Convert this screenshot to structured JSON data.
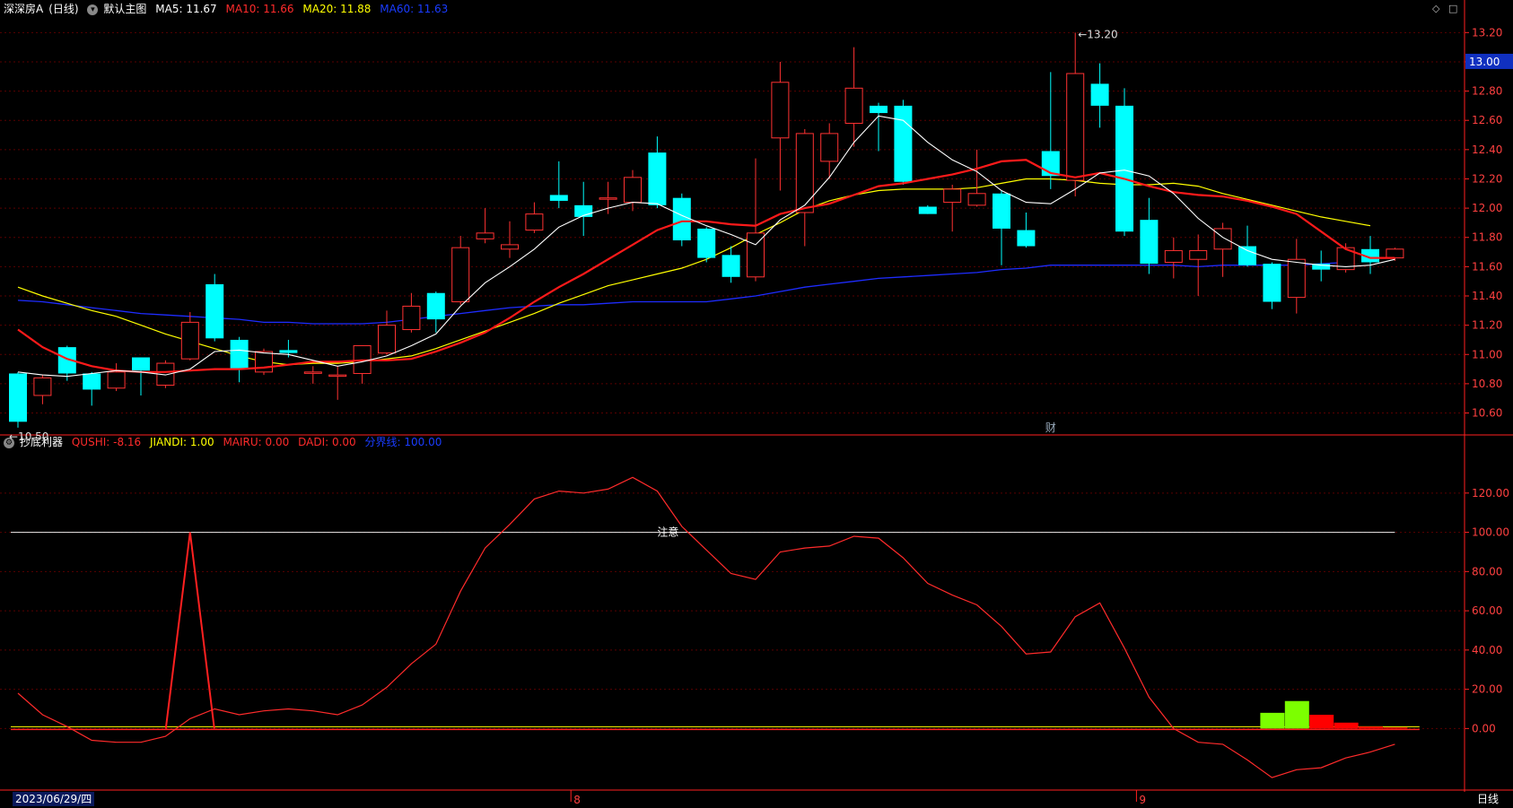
{
  "header": {
    "stock_name": "深深房A",
    "period": "(日线)",
    "template": "默认主图",
    "ma": [
      {
        "label": "MA5: 11.67",
        "color": "#ffffff"
      },
      {
        "label": "MA10: 11.66",
        "color": "#ff2b2b"
      },
      {
        "label": "MA20: 11.88",
        "color": "#ffff00"
      },
      {
        "label": "MA60: 11.63",
        "color": "#1a3cff"
      }
    ]
  },
  "indicator_header": {
    "name": "抄底利器",
    "values": [
      {
        "label": "QUSHI: -8.16",
        "color": "#ff2b2b"
      },
      {
        "label": "JIANDI: 1.00",
        "color": "#ffff00"
      },
      {
        "label": "MAIRU: 0.00",
        "color": "#ff2b2b"
      },
      {
        "label": "DADI: 0.00",
        "color": "#ff2b2b"
      },
      {
        "label": "分界线: 100.00",
        "color": "#1a3cff"
      }
    ]
  },
  "colors": {
    "up": "#ff3232",
    "down": "#00ffff",
    "ma5": "#ffffff",
    "ma10": "#ff1a1a",
    "ma20": "#ffff00",
    "ma60": "#1e2cff",
    "axis": "#ff2020",
    "grid": "#5a0000"
  },
  "chart_data": [
    {
      "type": "candlestick",
      "title": "深深房A (日线)",
      "ylim": [
        10.45,
        13.3
      ],
      "yticks": [
        "13.20",
        "13.00",
        "12.80",
        "12.60",
        "12.40",
        "12.20",
        "12.00",
        "11.80",
        "11.60",
        "11.40",
        "11.20",
        "11.00",
        "10.80",
        "10.60"
      ],
      "current_price": "13.00",
      "high_label": "13.20",
      "low_label": "10.50",
      "marker_label": "财",
      "candles": [
        {
          "o": 10.87,
          "c": 10.54,
          "h": 10.88,
          "l": 10.5
        },
        {
          "o": 10.72,
          "c": 10.84,
          "h": 10.86,
          "l": 10.66
        },
        {
          "o": 11.05,
          "c": 10.87,
          "h": 11.06,
          "l": 10.82
        },
        {
          "o": 10.87,
          "c": 10.76,
          "h": 10.88,
          "l": 10.65
        },
        {
          "o": 10.77,
          "c": 10.88,
          "h": 10.94,
          "l": 10.75
        },
        {
          "o": 10.98,
          "c": 10.89,
          "h": 10.98,
          "l": 10.72
        },
        {
          "o": 10.79,
          "c": 10.94,
          "h": 10.96,
          "l": 10.77
        },
        {
          "o": 10.97,
          "c": 11.22,
          "h": 11.29,
          "l": 10.96
        },
        {
          "o": 11.48,
          "c": 11.11,
          "h": 11.55,
          "l": 11.09
        },
        {
          "o": 11.1,
          "c": 10.9,
          "h": 11.12,
          "l": 10.81
        },
        {
          "o": 10.88,
          "c": 11.02,
          "h": 11.04,
          "l": 10.86
        },
        {
          "o": 11.03,
          "c": 11.01,
          "h": 11.1,
          "l": 10.98
        },
        {
          "o": 10.88,
          "c": 10.88,
          "h": 10.92,
          "l": 10.8
        },
        {
          "o": 10.86,
          "c": 10.86,
          "h": 10.92,
          "l": 10.69
        },
        {
          "o": 10.87,
          "c": 11.06,
          "h": 11.06,
          "l": 10.8
        },
        {
          "o": 11.01,
          "c": 11.2,
          "h": 11.3,
          "l": 11.0
        },
        {
          "o": 11.17,
          "c": 11.33,
          "h": 11.42,
          "l": 11.15
        },
        {
          "o": 11.42,
          "c": 11.24,
          "h": 11.43,
          "l": 11.15
        },
        {
          "o": 11.36,
          "c": 11.73,
          "h": 11.81,
          "l": 11.34
        },
        {
          "o": 11.79,
          "c": 11.83,
          "h": 12.0,
          "l": 11.76
        },
        {
          "o": 11.72,
          "c": 11.75,
          "h": 11.91,
          "l": 11.66
        },
        {
          "o": 11.85,
          "c": 11.96,
          "h": 12.04,
          "l": 11.83
        },
        {
          "o": 12.09,
          "c": 12.05,
          "h": 12.32,
          "l": 12.0
        },
        {
          "o": 12.02,
          "c": 11.94,
          "h": 12.18,
          "l": 11.81
        },
        {
          "o": 12.07,
          "c": 12.07,
          "h": 12.18,
          "l": 11.96
        },
        {
          "o": 12.04,
          "c": 12.21,
          "h": 12.26,
          "l": 11.98
        },
        {
          "o": 12.38,
          "c": 12.02,
          "h": 12.49,
          "l": 12.0
        },
        {
          "o": 12.07,
          "c": 11.78,
          "h": 12.1,
          "l": 11.74
        },
        {
          "o": 11.86,
          "c": 11.66,
          "h": 11.87,
          "l": 11.63
        },
        {
          "o": 11.68,
          "c": 11.53,
          "h": 11.74,
          "l": 11.49
        },
        {
          "o": 11.53,
          "c": 11.83,
          "h": 12.34,
          "l": 11.5
        },
        {
          "o": 12.48,
          "c": 12.86,
          "h": 13.0,
          "l": 12.12
        },
        {
          "o": 11.97,
          "c": 12.51,
          "h": 12.54,
          "l": 11.74
        },
        {
          "o": 12.32,
          "c": 12.51,
          "h": 12.58,
          "l": 12.2
        },
        {
          "o": 12.58,
          "c": 12.82,
          "h": 13.1,
          "l": 12.42
        },
        {
          "o": 12.7,
          "c": 12.65,
          "h": 12.72,
          "l": 12.39
        },
        {
          "o": 12.7,
          "c": 12.18,
          "h": 12.74,
          "l": 12.16
        },
        {
          "o": 12.01,
          "c": 11.96,
          "h": 12.02,
          "l": 11.96
        },
        {
          "o": 12.04,
          "c": 12.13,
          "h": 12.16,
          "l": 11.84
        },
        {
          "o": 12.02,
          "c": 12.1,
          "h": 12.4,
          "l": 12.01
        },
        {
          "o": 12.1,
          "c": 11.86,
          "h": 12.12,
          "l": 11.61
        },
        {
          "o": 11.85,
          "c": 11.74,
          "h": 11.97,
          "l": 11.73
        },
        {
          "o": 12.39,
          "c": 12.22,
          "h": 12.93,
          "l": 12.13
        },
        {
          "o": 12.19,
          "c": 12.92,
          "h": 13.2,
          "l": 12.08
        },
        {
          "o": 12.85,
          "c": 12.7,
          "h": 12.99,
          "l": 12.55
        },
        {
          "o": 12.7,
          "c": 11.84,
          "h": 12.82,
          "l": 11.81
        },
        {
          "o": 11.92,
          "c": 11.62,
          "h": 12.07,
          "l": 11.55
        },
        {
          "o": 11.63,
          "c": 11.71,
          "h": 11.8,
          "l": 11.52
        },
        {
          "o": 11.65,
          "c": 11.71,
          "h": 11.82,
          "l": 11.4
        },
        {
          "o": 11.72,
          "c": 11.86,
          "h": 11.9,
          "l": 11.53
        },
        {
          "o": 11.74,
          "c": 11.61,
          "h": 11.88,
          "l": 11.6
        },
        {
          "o": 11.62,
          "c": 11.36,
          "h": 11.63,
          "l": 11.31
        },
        {
          "o": 11.39,
          "c": 11.65,
          "h": 11.79,
          "l": 11.28
        },
        {
          "o": 11.62,
          "c": 11.58,
          "h": 11.71,
          "l": 11.5
        },
        {
          "o": 11.58,
          "c": 11.73,
          "h": 11.76,
          "l": 11.56
        },
        {
          "o": 11.72,
          "c": 11.63,
          "h": 11.81,
          "l": 11.55
        },
        {
          "o": 11.66,
          "c": 11.72,
          "h": 11.73,
          "l": 11.64
        }
      ],
      "ma5": [
        10.88,
        10.86,
        10.85,
        10.87,
        10.89,
        10.88,
        10.86,
        10.9,
        11.02,
        11.03,
        11.01,
        11.0,
        10.96,
        10.92,
        10.95,
        10.99,
        11.06,
        11.14,
        11.33,
        11.49,
        11.6,
        11.72,
        11.87,
        11.95,
        12.0,
        12.04,
        12.03,
        11.95,
        11.88,
        11.82,
        11.75,
        11.92,
        12.02,
        12.21,
        12.45,
        12.63,
        12.6,
        12.45,
        12.33,
        12.25,
        12.12,
        12.04,
        12.03,
        12.13,
        12.24,
        12.26,
        12.22,
        12.1,
        11.93,
        11.8,
        11.71,
        11.65,
        11.63,
        11.61,
        11.6,
        11.61,
        11.65
      ],
      "ma10": [
        11.17,
        11.05,
        10.97,
        10.92,
        10.89,
        10.88,
        10.88,
        10.89,
        10.9,
        10.9,
        10.91,
        10.93,
        10.95,
        10.95,
        10.96,
        10.96,
        10.97,
        11.02,
        11.08,
        11.15,
        11.25,
        11.36,
        11.46,
        11.55,
        11.65,
        11.75,
        11.85,
        11.91,
        11.91,
        11.89,
        11.88,
        11.96,
        12.0,
        12.03,
        12.09,
        12.15,
        12.17,
        12.2,
        12.23,
        12.27,
        12.32,
        12.33,
        12.24,
        12.21,
        12.24,
        12.2,
        12.15,
        12.11,
        12.09,
        12.08,
        12.05,
        12.01,
        11.96,
        11.84,
        11.72,
        11.66,
        11.66
      ],
      "ma20": [
        11.46,
        11.4,
        11.35,
        11.3,
        11.26,
        11.2,
        11.14,
        11.09,
        11.04,
        10.99,
        10.95,
        10.93,
        10.94,
        10.94,
        10.95,
        10.97,
        10.99,
        11.04,
        11.1,
        11.16,
        11.22,
        11.28,
        11.35,
        11.41,
        11.47,
        11.51,
        11.55,
        11.59,
        11.65,
        11.73,
        11.82,
        11.9,
        11.99,
        12.05,
        12.09,
        12.12,
        12.13,
        12.13,
        12.13,
        12.14,
        12.17,
        12.2,
        12.2,
        12.19,
        12.17,
        12.16,
        12.16,
        12.17,
        12.15,
        12.1,
        12.06,
        12.02,
        11.98,
        11.94,
        11.91,
        11.88
      ],
      "ma60": [
        11.37,
        11.36,
        11.34,
        11.32,
        11.3,
        11.28,
        11.27,
        11.26,
        11.25,
        11.24,
        11.22,
        11.22,
        11.21,
        11.21,
        11.21,
        11.22,
        11.24,
        11.26,
        11.28,
        11.3,
        11.32,
        11.33,
        11.34,
        11.34,
        11.35,
        11.36,
        11.36,
        11.36,
        11.36,
        11.38,
        11.4,
        11.43,
        11.46,
        11.48,
        11.5,
        11.52,
        11.53,
        11.54,
        11.55,
        11.56,
        11.58,
        11.59,
        11.61,
        11.61,
        11.61,
        11.61,
        11.61,
        11.61,
        11.6,
        11.61,
        11.61,
        11.61,
        11.61,
        11.62,
        11.63
      ]
    },
    {
      "type": "line",
      "title": "抄底利器",
      "ylim": [
        -30,
        135
      ],
      "yticks": [
        "120.00",
        "100.00",
        "80.00",
        "60.00",
        "40.00",
        "20.00",
        "0.00"
      ],
      "annotation": "注意",
      "threshold": 100,
      "series": [
        {
          "name": "QUSHI",
          "color": "#ff2b2b",
          "values": [
            18,
            7,
            1,
            -6,
            -7,
            -7,
            -4,
            5,
            10,
            7,
            9,
            10,
            9,
            7,
            12,
            21,
            33,
            43,
            70,
            92,
            104,
            117,
            121,
            120,
            122,
            128,
            121,
            103,
            91,
            79,
            76,
            90,
            92,
            93,
            98,
            97,
            87,
            74,
            68,
            63,
            52,
            38,
            39,
            57,
            64,
            41,
            16,
            0,
            -7,
            -8,
            -16,
            -25,
            -21,
            -20,
            -15,
            -12,
            -8
          ]
        },
        {
          "name": "JIANDI",
          "color": "#ff2020",
          "spike_index": 7,
          "spike_value": 100,
          "base": 1
        }
      ],
      "bars": [
        {
          "index": 51,
          "value": 8,
          "color": "#7cff00"
        },
        {
          "index": 52,
          "value": 14,
          "color": "#7cff00"
        },
        {
          "index": 53,
          "value": 7,
          "color": "#ff0000"
        },
        {
          "index": 54,
          "value": 3,
          "color": "#ff0000"
        },
        {
          "index": 55,
          "value": 1,
          "color": "#ff0000"
        },
        {
          "index": 56,
          "value": 0.5,
          "color": "#ff0000"
        }
      ]
    }
  ],
  "footer": {
    "date_label": "2023/06/29/四",
    "month_marks": [
      {
        "index": 23,
        "label": "8"
      },
      {
        "index": 46,
        "label": "9"
      }
    ],
    "period_button": "日线"
  }
}
